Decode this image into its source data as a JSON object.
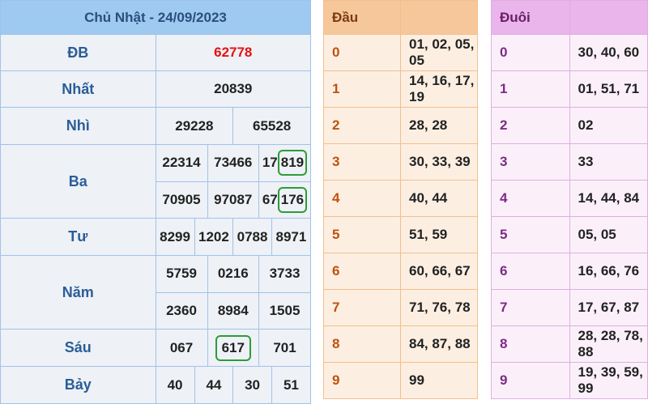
{
  "prize": {
    "title": "Chủ Nhật - 24/09/2023",
    "db": {
      "label": "ĐB",
      "value": "62778"
    },
    "nhat": {
      "label": "Nhất",
      "value": "20839"
    },
    "nhi": {
      "label": "Nhì",
      "values": [
        "29228",
        "65528"
      ]
    },
    "ba": {
      "label": "Ba",
      "row1": [
        "22314",
        "73466",
        "17819"
      ],
      "row2": [
        "70905",
        "97087",
        "67176"
      ],
      "highlight_prefix": [
        "17",
        "67"
      ],
      "highlight_suffix": [
        "819",
        "176"
      ]
    },
    "tu": {
      "label": "Tư",
      "values": [
        "8299",
        "1202",
        "0788",
        "8971"
      ]
    },
    "nam": {
      "label": "Năm",
      "row1": [
        "5759",
        "0216",
        "3733"
      ],
      "row2": [
        "2360",
        "8984",
        "1505"
      ]
    },
    "sau": {
      "label": "Sáu",
      "values": [
        "067",
        "617",
        "701"
      ]
    },
    "bay": {
      "label": "Bảy",
      "values": [
        "40",
        "44",
        "30",
        "51"
      ]
    },
    "circle_color": "#2c9c3a"
  },
  "dau": {
    "title": "Đầu",
    "rows": [
      {
        "key": "0",
        "value": "01, 02, 05, 05"
      },
      {
        "key": "1",
        "value": "14, 16, 17, 19"
      },
      {
        "key": "2",
        "value": "28, 28"
      },
      {
        "key": "3",
        "value": "30, 33, 39"
      },
      {
        "key": "4",
        "value": "40, 44"
      },
      {
        "key": "5",
        "value": "51, 59"
      },
      {
        "key": "6",
        "value": "60, 66, 67"
      },
      {
        "key": "7",
        "value": "71, 76, 78"
      },
      {
        "key": "8",
        "value": "84, 87, 88"
      },
      {
        "key": "9",
        "value": "99"
      }
    ]
  },
  "duoi": {
    "title": "Đuôi",
    "rows": [
      {
        "key": "0",
        "value": "30, 40, 60"
      },
      {
        "key": "1",
        "value": "01, 51, 71"
      },
      {
        "key": "2",
        "value": "02"
      },
      {
        "key": "3",
        "value": "33"
      },
      {
        "key": "4",
        "value": "14, 44, 84"
      },
      {
        "key": "5",
        "value": "05, 05"
      },
      {
        "key": "6",
        "value": "16, 66, 76"
      },
      {
        "key": "7",
        "value": "17, 67, 87"
      },
      {
        "key": "8",
        "value": "28, 28, 78, 88"
      },
      {
        "key": "9",
        "value": "19, 39, 59, 99"
      }
    ]
  }
}
